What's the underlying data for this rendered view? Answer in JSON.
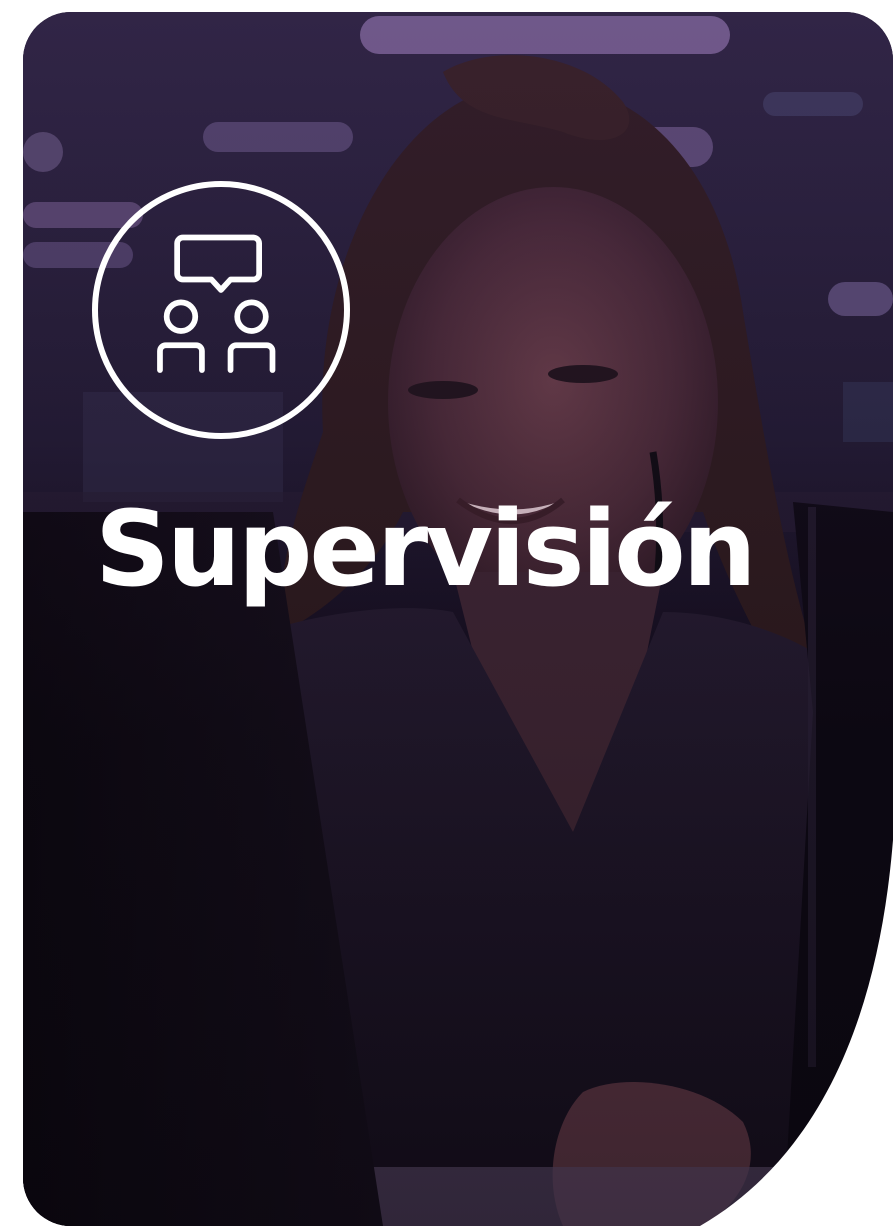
{
  "hero": {
    "title": "Supervisión",
    "icon": "supervision-chat-people-icon",
    "background": "woman-at-computer-photo"
  },
  "colors": {
    "overlay_tint": "#4b2b63",
    "text": "#ffffff",
    "card_dark": "#120c1c",
    "page_bg": "#ffffff"
  }
}
